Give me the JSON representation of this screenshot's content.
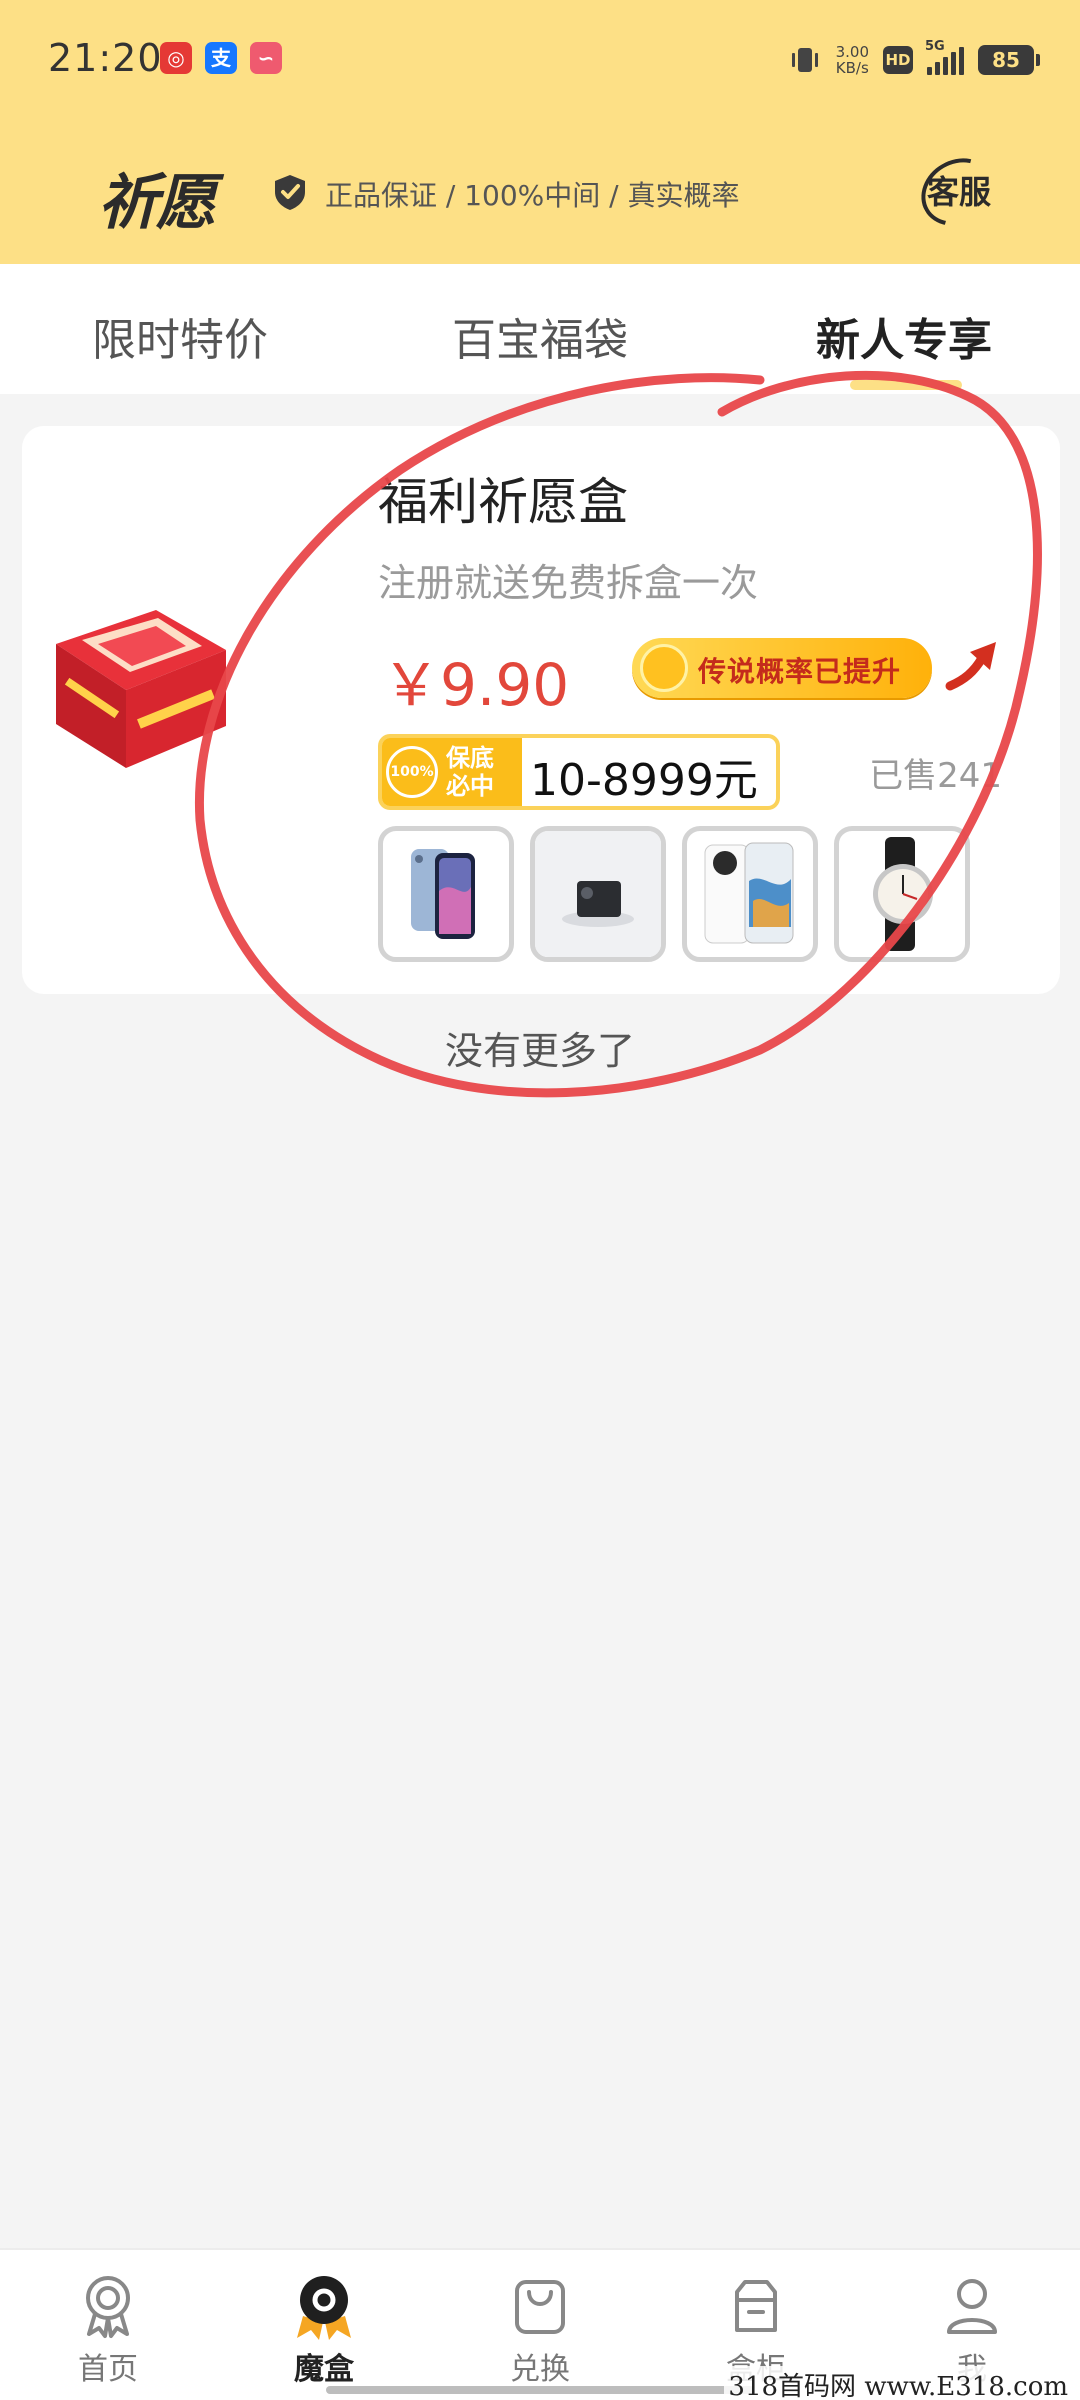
{
  "status_bar": {
    "time": "21:20",
    "net_speed_value": "3.00",
    "net_speed_unit": "KB/s",
    "hd_label": "HD",
    "network_label": "5G",
    "battery_level": "85"
  },
  "header": {
    "brand": "祈愿",
    "guarantee_text": "正品保证 / 100%中间 / 真实概率",
    "service_label": "客服",
    "background_color": "#fde086"
  },
  "tabs": [
    {
      "label": "限时特价",
      "active": false
    },
    {
      "label": "百宝福袋",
      "active": false
    },
    {
      "label": "新人专享",
      "active": true
    }
  ],
  "product": {
    "title": "福利祈愿盒",
    "subtitle": "注册就送免费拆盒一次",
    "price": "￥9.90",
    "promo_text": "传说概率已提升",
    "guarantee_percent": "100%",
    "guarantee_line1": "保底",
    "guarantee_line2": "必中",
    "range": "10-8999元",
    "sold": "已售241",
    "thumbnails": [
      "phone-thumbnail",
      "projector-thumbnail",
      "smartphone-thumbnail",
      "watch-thumbnail"
    ]
  },
  "no_more_text": "没有更多了",
  "bottom_nav": [
    {
      "label": "首页",
      "icon": "award-icon",
      "active": false
    },
    {
      "label": "魔盒",
      "icon": "magic-box-icon",
      "active": true
    },
    {
      "label": "兑换",
      "icon": "shopping-bag-icon",
      "active": false
    },
    {
      "label": "盒柜",
      "icon": "cabinet-icon",
      "active": false
    },
    {
      "label": "我",
      "icon": "user-icon",
      "active": false
    }
  ],
  "watermark": "318首码网  www.E318.com",
  "colors": {
    "accent": "#fde086",
    "price": "#e2473b",
    "annotation": "#e8474a"
  }
}
